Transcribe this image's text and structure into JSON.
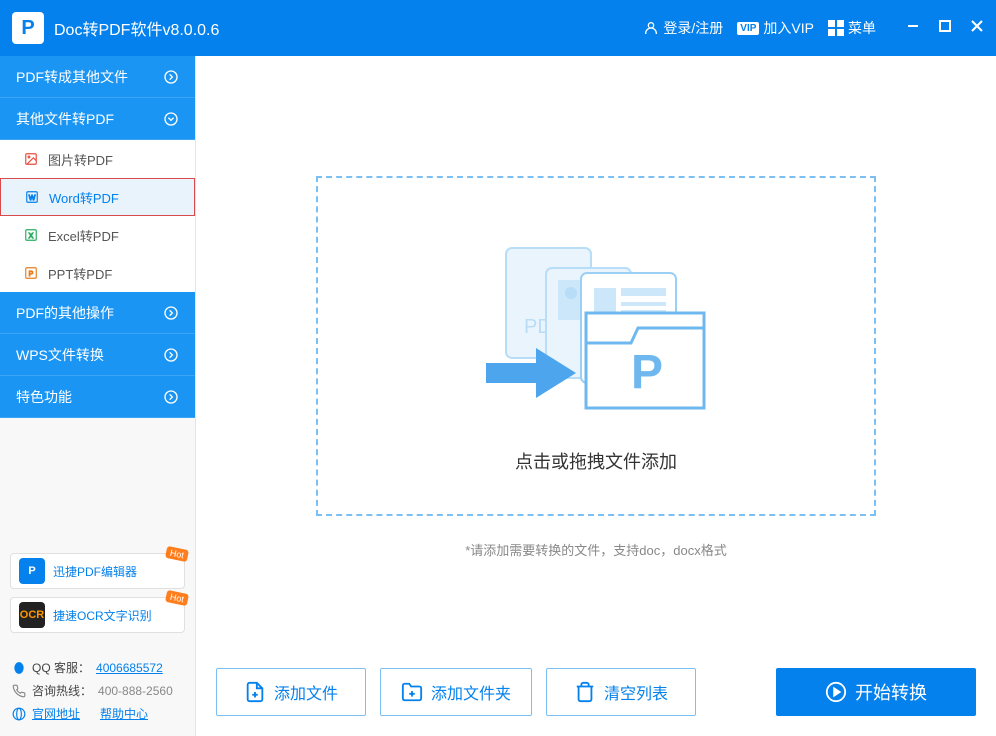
{
  "app": {
    "title": "Doc转PDF软件v8.0.0.6"
  },
  "titlebar": {
    "login": "登录/注册",
    "vip": "加入VIP",
    "menu": "菜单"
  },
  "sidebar": {
    "sections": [
      {
        "label": "PDF转成其他文件",
        "expanded": false
      },
      {
        "label": "其他文件转PDF",
        "expanded": true
      },
      {
        "label": "PDF的其他操作",
        "expanded": false
      },
      {
        "label": "WPS文件转换",
        "expanded": false
      },
      {
        "label": "特色功能",
        "expanded": false
      }
    ],
    "items": [
      {
        "label": "图片转PDF"
      },
      {
        "label": "Word转PDF"
      },
      {
        "label": "Excel转PDF"
      },
      {
        "label": "PPT转PDF"
      }
    ]
  },
  "promos": [
    {
      "label": "迅捷PDF编辑器",
      "badge": "Hot"
    },
    {
      "label": "捷速OCR文字识别",
      "badge": "Hot"
    }
  ],
  "contact": {
    "qq_label": "QQ 客服：",
    "qq_value": "4006685572",
    "hotline_label": "咨询热线：",
    "hotline_value": "400-888-2560",
    "site_label": "官网地址",
    "help_label": "帮助中心"
  },
  "main": {
    "drop_text": "点击或拖拽文件添加",
    "hint": "*请添加需要转换的文件，支持doc，docx格式",
    "add_file": "添加文件",
    "add_folder": "添加文件夹",
    "clear_list": "清空列表",
    "start": "开始转换"
  }
}
